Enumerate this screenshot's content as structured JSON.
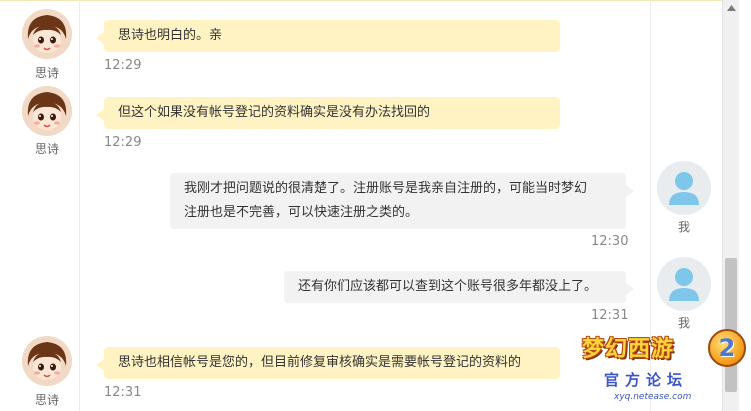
{
  "agent": {
    "name": "思诗",
    "bubble_color": "#fff3c4"
  },
  "user": {
    "name": "我",
    "bubble_color": "#f2f2f2",
    "avatar_color": "#7ec6ea"
  },
  "messages": [
    {
      "sender": "思诗",
      "text": "思诗也明白的。亲",
      "time": "12:29"
    },
    {
      "sender": "思诗",
      "text": "但这个如果没有帐号登记的资料确实是没有办法找回的",
      "time": "12:29"
    },
    {
      "sender": "我",
      "line1": "我刚才把问题说的很清楚了。注册账号是我亲自注册的，可能当时梦幻",
      "line2": "注册也是不完善，可以快速注册之类的。",
      "time": "12:30"
    },
    {
      "sender": "我",
      "text": "还有你们应该都可以查到这个账号很多年都没上了。",
      "time": "12:31"
    },
    {
      "sender": "思诗",
      "text": "思诗也相信帐号是您的，但目前修复审核确实是需要帐号登记的资料的",
      "time": "12:31"
    }
  ],
  "watermark": {
    "title": "梦幻西游",
    "number": "2",
    "subtitle": "官方论坛",
    "url": "xyq.netease.com"
  }
}
